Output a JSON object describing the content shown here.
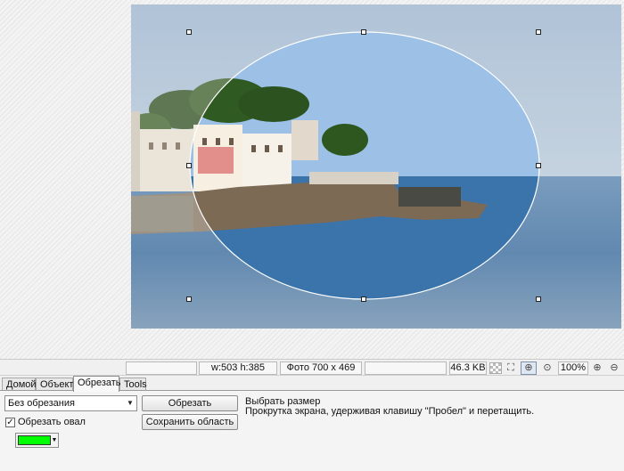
{
  "canvas": {
    "selection": {
      "width_text": "w:503 h:385",
      "shape": "ellipse"
    }
  },
  "statusbar": {
    "size_text": "w:503 h:385",
    "photo_text": "Фото 700 x 469",
    "filesize": "46.3 KB",
    "zoom": "100%",
    "icons": [
      "checkerboard-icon",
      "fit-screen-icon",
      "actual-size-icon",
      "zoom-fit-icon",
      "zoom-in-icon",
      "zoom-out-icon"
    ]
  },
  "tabs": [
    {
      "label": "Домой",
      "active": false
    },
    {
      "label": "Объект",
      "active": false
    },
    {
      "label": "Обрезать",
      "active": true
    },
    {
      "label": "Tools",
      "active": false
    }
  ],
  "panel": {
    "crop_mode": "Без обрезания",
    "crop_button": "Обрезать",
    "save_area_button": "Сохранить область",
    "oval_label": "Обрезать овал",
    "oval_checked": true,
    "oval_check_glyph": "✓",
    "color": "#00ff00",
    "info_line1": "Выбрать размер",
    "info_line2": "Прокрутка экрана, удерживая клавишу \"Пробел\" и перетащить."
  }
}
